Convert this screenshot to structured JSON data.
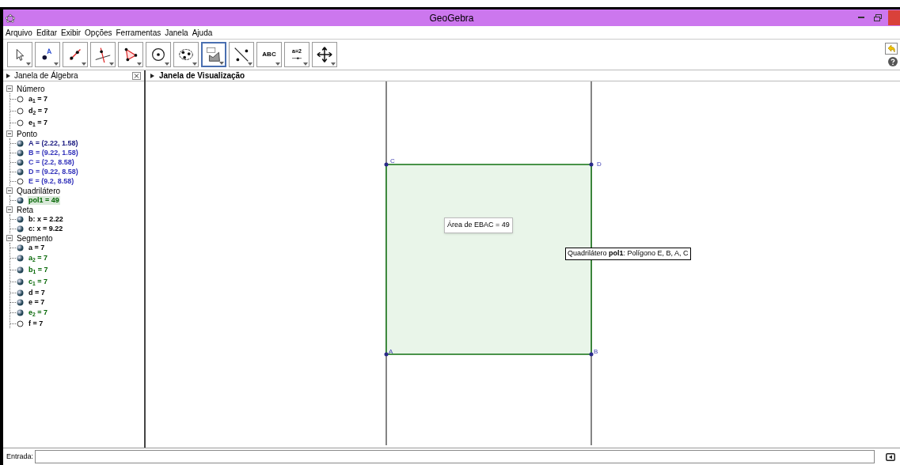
{
  "window": {
    "title": "GeoGebra"
  },
  "menu": [
    "Arquivo",
    "Editar",
    "Exibir",
    "Opções",
    "Ferramentas",
    "Janela",
    "Ajuda"
  ],
  "toolbar": [
    {
      "kind": "move",
      "selected": false
    },
    {
      "kind": "point",
      "selected": false
    },
    {
      "kind": "line",
      "selected": false
    },
    {
      "kind": "perpendicular",
      "selected": false
    },
    {
      "kind": "polygon",
      "selected": false
    },
    {
      "kind": "circle",
      "selected": false
    },
    {
      "kind": "conic",
      "selected": false
    },
    {
      "kind": "measure",
      "selected": true
    },
    {
      "kind": "reflect",
      "selected": false
    },
    {
      "kind": "text",
      "label": "ABC",
      "selected": false
    },
    {
      "kind": "slider",
      "label": "a=2",
      "selected": false
    },
    {
      "kind": "pan",
      "selected": false
    }
  ],
  "algebra": {
    "title": "Janela de Álgebra",
    "groups": [
      {
        "name": "Número",
        "expanded": true,
        "items": [
          {
            "text": "a$_{1}$ = 7",
            "shown": false,
            "selected": false,
            "color": "#000000"
          },
          {
            "text": "d$_{2}$ = 7",
            "shown": false,
            "selected": false,
            "color": "#000000"
          },
          {
            "text": "e$_{1}$ = 7",
            "shown": false,
            "selected": false,
            "color": "#000000"
          }
        ]
      },
      {
        "name": "Ponto",
        "expanded": true,
        "items": [
          {
            "text": "A = (2.22, 1.58)",
            "shown": true,
            "selected": false,
            "color": "#1a1a80"
          },
          {
            "text": "B = (9.22, 1.58)",
            "shown": true,
            "selected": false,
            "color": "#3333bb"
          },
          {
            "text": "C = (2.2, 8.58)",
            "shown": true,
            "selected": false,
            "color": "#3333bb"
          },
          {
            "text": "D = (9.22, 8.58)",
            "shown": true,
            "selected": false,
            "color": "#3333bb"
          },
          {
            "text": "E = (9.2, 8.58)",
            "shown": false,
            "selected": false,
            "color": "#3333bb"
          }
        ]
      },
      {
        "name": "Quadrilátero",
        "expanded": true,
        "items": [
          {
            "text": "pol1 = 49",
            "shown": true,
            "selected": true,
            "color": "#006400"
          }
        ]
      },
      {
        "name": "Reta",
        "expanded": true,
        "items": [
          {
            "text": "b: x = 2.22",
            "shown": true,
            "selected": false,
            "color": "#000000"
          },
          {
            "text": "c: x = 9.22",
            "shown": true,
            "selected": false,
            "color": "#000000"
          }
        ]
      },
      {
        "name": "Segmento",
        "expanded": true,
        "items": [
          {
            "text": "a = 7",
            "shown": true,
            "selected": false,
            "color": "#000000"
          },
          {
            "text": "a$_{2}$ = 7",
            "shown": true,
            "selected": false,
            "color": "#006400"
          },
          {
            "text": "b$_{1}$ = 7",
            "shown": true,
            "selected": false,
            "color": "#006400"
          },
          {
            "text": "c$_{1}$ = 7",
            "shown": true,
            "selected": false,
            "color": "#006400"
          },
          {
            "text": "d = 7",
            "shown": true,
            "selected": false,
            "color": "#000000"
          },
          {
            "text": "e = 7",
            "shown": true,
            "selected": false,
            "color": "#000000"
          },
          {
            "text": "e$_{2}$ = 7",
            "shown": true,
            "selected": false,
            "color": "#006400"
          },
          {
            "text": "f = 7",
            "shown": false,
            "selected": false,
            "color": "#000000"
          }
        ]
      }
    ]
  },
  "graphics": {
    "title": "Janela de Visualização",
    "points": [
      {
        "label": "C"
      },
      {
        "label": "D"
      },
      {
        "label": "A"
      },
      {
        "label": "B"
      }
    ],
    "area_label": "Área de  EBAC = 49",
    "tooltip": "Quadrilátero **pol1**: Polígono E, B, A, C"
  },
  "input": {
    "label": "Entrada:"
  }
}
